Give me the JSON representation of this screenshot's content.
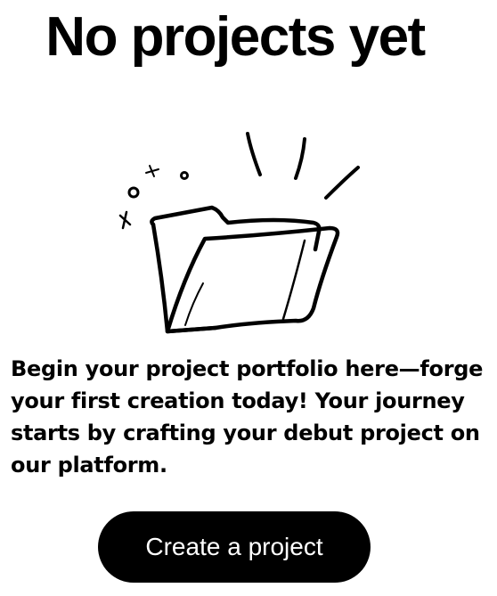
{
  "empty_state": {
    "title": "No projects yet",
    "illustration_icon": "open-folder-icon",
    "description": "Begin your project portfolio here—forge your first creation today! Your journey starts by crafting your debut project on our platform.",
    "cta_label": "Create a project"
  },
  "colors": {
    "background": "#ffffff",
    "text": "#000000",
    "button_background": "#000000",
    "button_text": "#ffffff"
  }
}
